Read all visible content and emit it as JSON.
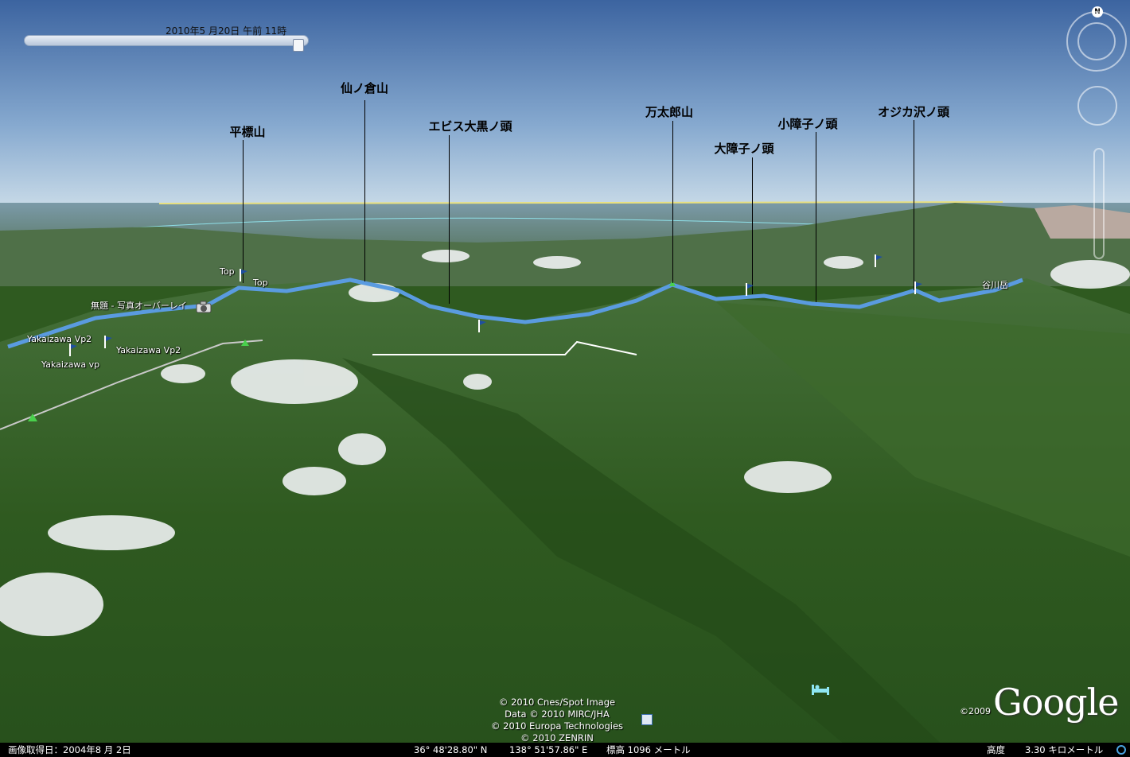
{
  "time_slider": {
    "label": "2010年5 月20日 午前 11時"
  },
  "peak_labels": [
    "平標山",
    "仙ノ倉山",
    "エビス大黒ノ頭",
    "万太郎山",
    "大障子ノ頭",
    "小障子ノ頭",
    "オジカ沢ノ頭"
  ],
  "map_labels": {
    "top1": "Top",
    "top2": "Top",
    "photo_overlay": "無題 - 写真オーバーレイ",
    "vp2_a": "Yakaizawa Vp2",
    "vp2_b": "Yakaizawa Vp2",
    "vp": "Yakaizawa vp",
    "tanigawa": "谷川岳"
  },
  "navigation": {
    "north_letter": "N"
  },
  "copyright": [
    "© 2010 Cnes/Spot Image",
    "Data © 2010 MIRC/JHA",
    "© 2010 Europa Technologies",
    "© 2010 ZENRIN"
  ],
  "logo": {
    "text": "Google",
    "year": "©2009"
  },
  "status_bar": {
    "imagery_date": "画像取得日：2004年8 月 2日",
    "latitude": "36° 48'28.80\" N",
    "longitude": "138° 51'57.86\" E",
    "elevation": "標高 1096 メートル",
    "altitude_label": "高度",
    "altitude_value": "3.30 キロメートル"
  },
  "colors": {
    "route": "#5a9be0",
    "sky_top": "#3c64a0",
    "forest": "#2f5a20"
  }
}
